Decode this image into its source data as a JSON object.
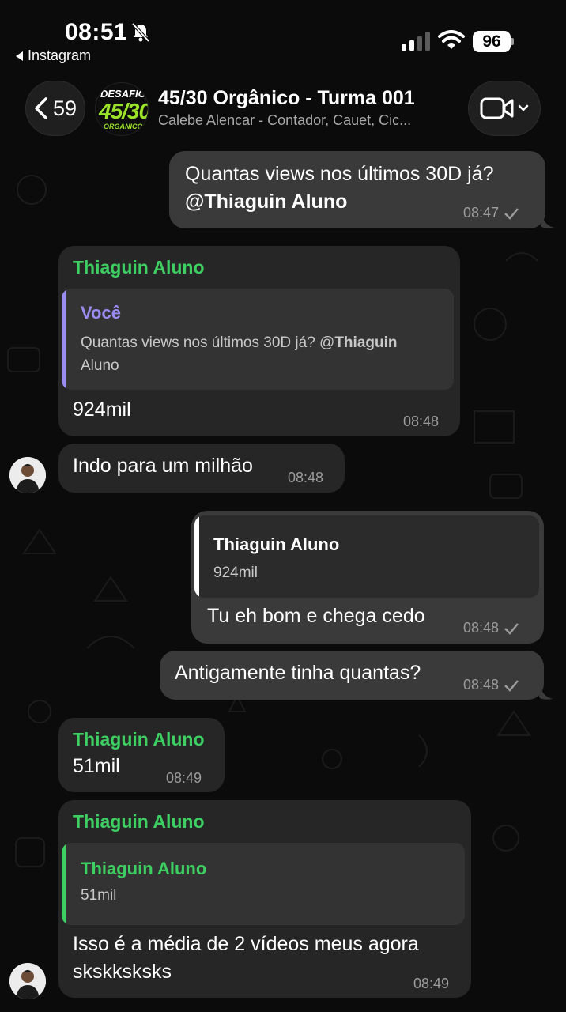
{
  "status_bar": {
    "time": "08:51",
    "back_app": "Instagram",
    "battery": "96"
  },
  "header": {
    "unread_count": "59",
    "avatar_text": [
      "DESAFIO",
      "45/30",
      "ORGÂNICO"
    ],
    "title": "45/30 Orgânico - Turma 001",
    "subtitle": "Calebe Alencar - Contador, Cauet, Cic..."
  },
  "messages": [
    {
      "direction": "out",
      "text_line1": "Quantas views nos últimos 30D já?",
      "mention": "@Thiaguin Aluno",
      "time": "08:47",
      "status": "sent"
    },
    {
      "direction": "in",
      "sender": "Thiaguin Aluno",
      "quote": {
        "name": "Você",
        "text_line1": "Quantas views nos últimos 30D já? @",
        "text_bold1": "Thiaguin",
        "text_line2": "Aluno"
      },
      "text": "924mil",
      "time": "08:48"
    },
    {
      "direction": "in",
      "text": "Indo para um milhão",
      "time": "08:48"
    },
    {
      "direction": "out",
      "quote": {
        "name": "Thiaguin Aluno",
        "text": "924mil"
      },
      "text": "Tu eh bom e chega cedo",
      "time": "08:48",
      "status": "sent"
    },
    {
      "direction": "out",
      "text": "Antigamente tinha quantas?",
      "time": "08:48",
      "status": "sent"
    },
    {
      "direction": "in",
      "sender": "Thiaguin Aluno",
      "text": "51mil",
      "time": "08:49"
    },
    {
      "direction": "in",
      "sender": "Thiaguin Aluno",
      "quote": {
        "name": "Thiaguin Aluno",
        "text": "51mil"
      },
      "text_line1": "Isso é a média de 2 vídeos meus agora",
      "text_line2": "skskksksks",
      "time": "08:49"
    }
  ],
  "colors": {
    "background": "#0b0b0b",
    "incoming_bubble": "#262626",
    "outgoing_bubble": "#3a3a3a",
    "sender_green": "#3ecf62",
    "quote_purple": "#9b8cf0",
    "brand_lime": "#9be22a"
  },
  "icons": [
    "bell-slash-icon",
    "signal-icon",
    "wifi-icon",
    "battery-icon",
    "chevron-left-icon",
    "video-camera-icon",
    "chevron-down-icon",
    "checkmark-icon"
  ]
}
